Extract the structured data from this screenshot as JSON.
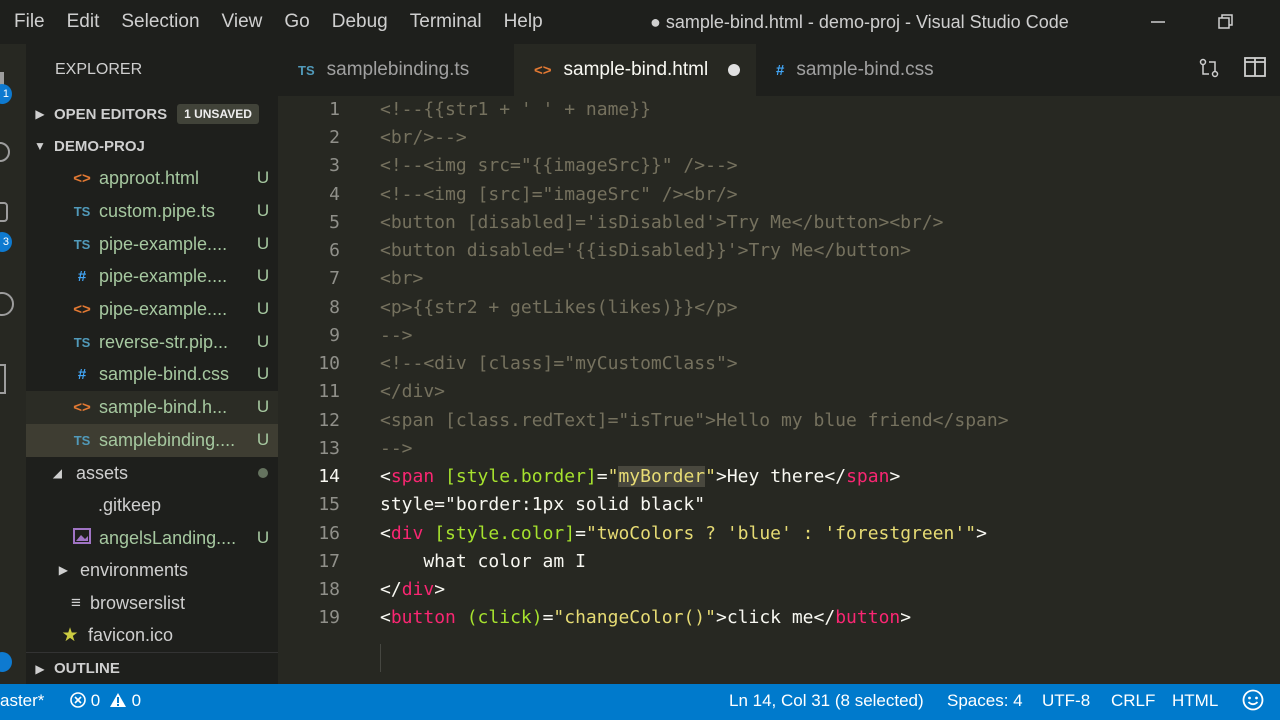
{
  "menu": [
    "File",
    "Edit",
    "Selection",
    "View",
    "Go",
    "Debug",
    "Terminal",
    "Help"
  ],
  "window_title": "● sample-bind.html - demo-proj - Visual Studio Code",
  "activity": {
    "badge_a": "1",
    "badge_b": "3"
  },
  "sidebar": {
    "header": "EXPLORER",
    "open_editors_label": "OPEN EDITORS",
    "open_editors_badge": "1 UNSAVED",
    "project_label": "DEMO-PROJ",
    "outline_label": "OUTLINE",
    "files": [
      {
        "icon": "html-file-icon",
        "glyph": "<>",
        "name": "approot.html",
        "status": "U"
      },
      {
        "icon": "ts-file-icon",
        "glyph": "TS",
        "name": "custom.pipe.ts",
        "status": "U"
      },
      {
        "icon": "ts-file-icon",
        "glyph": "TS",
        "name": "pipe-example....",
        "status": "U"
      },
      {
        "icon": "css-file-icon",
        "glyph": "#",
        "name": "pipe-example....",
        "status": "U"
      },
      {
        "icon": "html-file-icon",
        "glyph": "<>",
        "name": "pipe-example....",
        "status": "U"
      },
      {
        "icon": "ts-file-icon",
        "glyph": "TS",
        "name": "reverse-str.pip...",
        "status": "U"
      },
      {
        "icon": "css-file-icon",
        "glyph": "#",
        "name": "sample-bind.css",
        "status": "U"
      },
      {
        "icon": "html-file-icon",
        "glyph": "<>",
        "name": "sample-bind.h...",
        "status": "U"
      },
      {
        "icon": "ts-file-icon",
        "glyph": "TS",
        "name": "samplebinding....",
        "status": "U"
      }
    ],
    "assets_label": "assets",
    "gitkeep_label": ".gitkeep",
    "image_file": {
      "name": "angelsLanding....",
      "status": "U"
    },
    "environments_label": "environments",
    "browserslist_label": "browserslist",
    "favicon_label": "favicon.ico"
  },
  "tabs": [
    {
      "glyph": "TS",
      "label": "samplebinding.ts"
    },
    {
      "glyph": "<>",
      "label": "sample-bind.html"
    },
    {
      "glyph": "#",
      "label": "sample-bind.css"
    }
  ],
  "editor": {
    "line_numbers": [
      "1",
      "2",
      "3",
      "4",
      "5",
      "6",
      "7",
      "8",
      "9",
      "10",
      "11",
      "12",
      "13",
      "14",
      "15",
      "16",
      "17",
      "18",
      "19"
    ],
    "lines": [
      "<!--{{str1 + ' ' + name}}",
      "<br/>-->",
      "<!--<img src=\"{{imageSrc}}\" />-->",
      "<!--<img [src]=\"imageSrc\" /><br/>",
      "<button [disabled]='isDisabled'>Try Me</button><br/>",
      "<button disabled='{{isDisabled}}'>Try Me</button>",
      "<br>",
      "<p>{{str2 + getLikes(likes)}}</p>",
      "-->",
      "<!--<div [class]=\"myCustomClass\">",
      "</div>",
      "<span [class.redText]=\"isTrue\">Hello my blue friend</span>",
      "-->",
      "<span [style.border]=\"myBorder\">Hey there</span>",
      "style=\"border:1px solid black\"",
      "<div [style.color]=\"twoColors ? 'blue' : 'forestgreen'\">",
      "    what color am I",
      "</div>",
      "<button (click)=\"changeColor()\">click me</button>"
    ]
  },
  "status": {
    "branch": "aster*",
    "errors": "0",
    "warnings": "0",
    "position": "Ln 14, Col 31 (8 selected)",
    "spaces": "Spaces: 4",
    "encoding": "UTF-8",
    "eol": "CRLF",
    "language": "HTML"
  }
}
